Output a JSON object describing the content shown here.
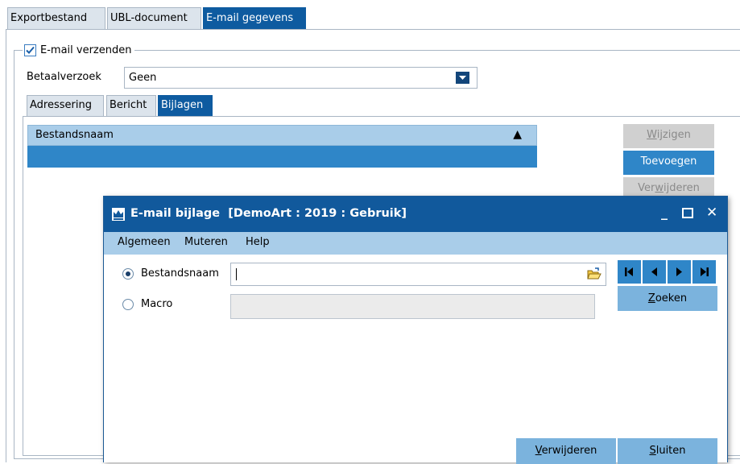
{
  "top_tabs": [
    {
      "label": "Exportbestand",
      "active": false
    },
    {
      "label": "UBL-document",
      "active": false
    },
    {
      "label": "E-mail gegevens",
      "active": true
    }
  ],
  "email_group": {
    "checkbox_label": "E-mail verzenden",
    "checked": true
  },
  "betaalverzoek": {
    "label": "Betaalverzoek",
    "value": "Geen"
  },
  "sub_tabs": [
    {
      "label": "Adressering",
      "active": false
    },
    {
      "label": "Bericht",
      "active": false
    },
    {
      "label": "Bijlagen",
      "active": true
    }
  ],
  "grid": {
    "column_header": "Bestandsnaam",
    "sort_indicator": "▲"
  },
  "side_buttons": {
    "edit_prefix": "",
    "edit_underlined": "W",
    "edit_suffix": "ijzigen",
    "add_prefix": "Toevoe",
    "add_underlined": "g",
    "add_suffix": "en",
    "delete_prefix": "Ver",
    "delete_underlined": "w",
    "delete_suffix": "ijderen"
  },
  "dialog": {
    "title": "E-mail bijlage  [DemoArt : 2019 : Gebruik]",
    "controls": {
      "minimize": "_",
      "maximize": "☐",
      "close": "✕"
    },
    "menu": [
      "Algemeen",
      "Muteren",
      "Help"
    ],
    "radio_file_label": "Bestandsnaam",
    "radio_macro_label": "Macro",
    "selected_radio": "Bestandsnaam",
    "file_value": "",
    "macro_value": "",
    "search_prefix": "",
    "search_underlined": "Z",
    "search_suffix": "oeken",
    "delete_prefix": "",
    "delete_underlined": "V",
    "delete_suffix": "erwijderen",
    "close_prefix": "",
    "close_underlined": "S",
    "close_suffix": "luiten"
  },
  "colors": {
    "accent": "#0e5ba0",
    "button_blue": "#2f86c8",
    "grid_header": "#a9cde9",
    "dialog_menu": "#a9cde9"
  }
}
